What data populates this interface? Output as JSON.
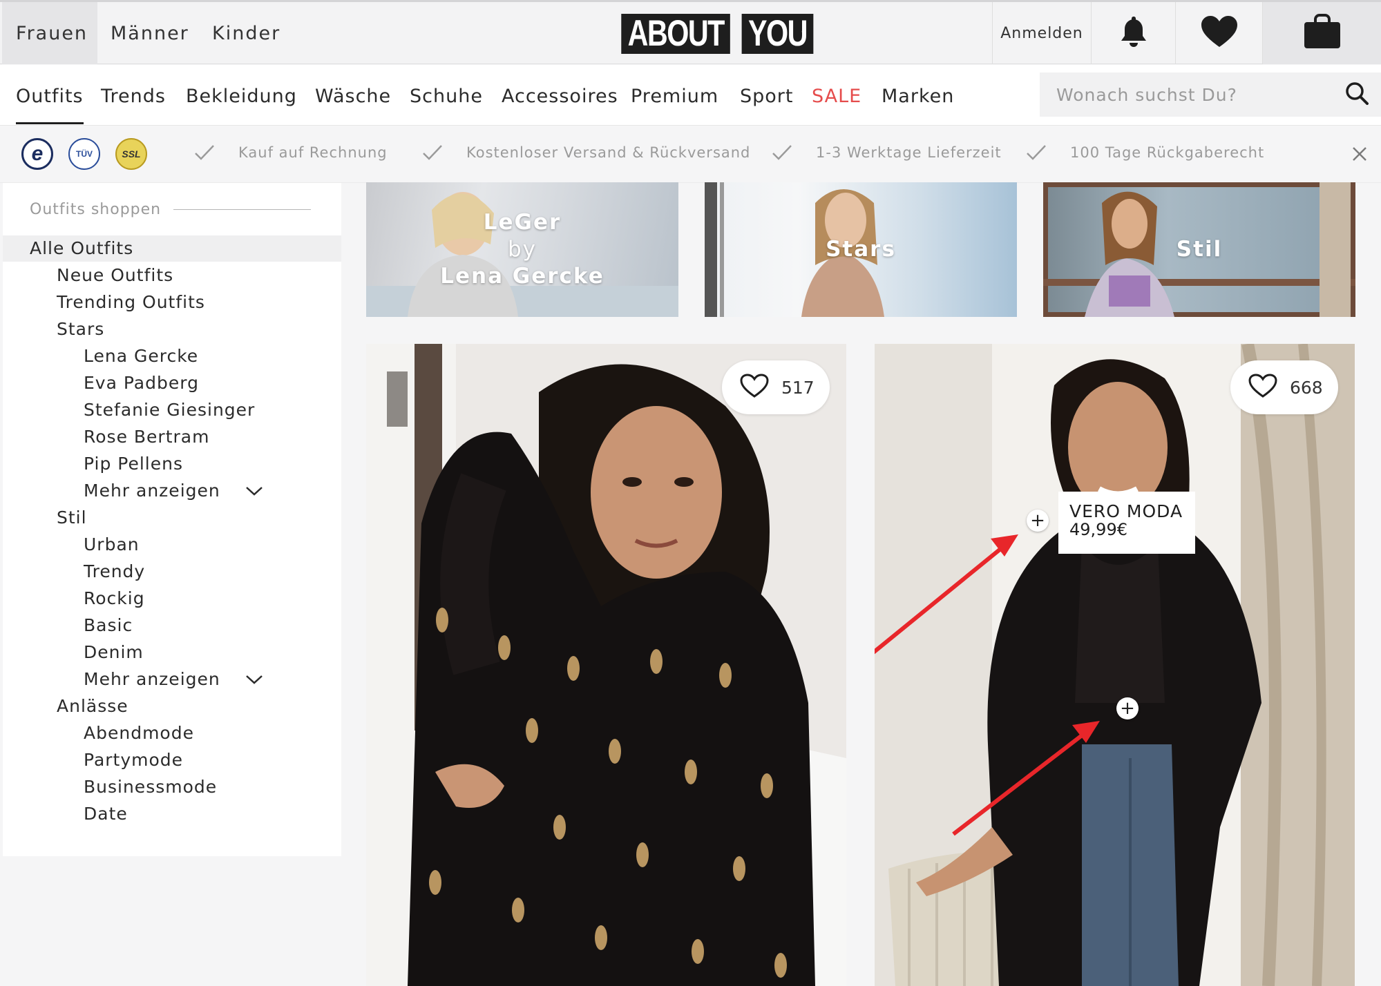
{
  "header": {
    "gender_tabs": [
      "Frauen",
      "Männer",
      "Kinder"
    ],
    "logo": {
      "part1": "ABOUT",
      "part2": "YOU",
      "mark": "°"
    },
    "login_label": "Anmelden",
    "icons": [
      "bell-icon",
      "heart-icon",
      "shopping-bag-icon"
    ]
  },
  "nav": {
    "categories": [
      "Outfits",
      "Trends",
      "Bekleidung",
      "Wäsche",
      "Schuhe",
      "Accessoires",
      "Premium",
      "Sport",
      "SALE",
      "Marken"
    ],
    "active": "Outfits",
    "search_placeholder": "Wonach suchst Du?"
  },
  "trust": {
    "seals": [
      "e",
      "TÜV",
      "SSL"
    ],
    "usps": [
      "Kauf auf Rechnung",
      "Kostenloser Versand & Rückversand",
      "1-3 Werktage Lieferzeit",
      "100 Tage Rückgaberecht"
    ]
  },
  "sidebar": {
    "heading": "Outfits shoppen",
    "items": [
      "Alle Outfits",
      "Neue Outfits",
      "Trending Outfits",
      "Stars",
      "Lena Gercke",
      "Eva Padberg",
      "Stefanie Giesinger",
      "Rose Bertram",
      "Pip Pellens",
      "Mehr anzeigen",
      "Stil",
      "Urban",
      "Trendy",
      "Rockig",
      "Basic",
      "Denim",
      "Mehr anzeigen",
      "Anlässe",
      "Abendmode",
      "Partymode",
      "Businessmode",
      "Date"
    ]
  },
  "teasers": [
    {
      "line1": "LeGer",
      "line2": "by",
      "line3": "Lena Gercke"
    },
    {
      "line1": "Stars"
    },
    {
      "line1": "Stil"
    }
  ],
  "outfits": [
    {
      "likes": "517"
    },
    {
      "likes": "668",
      "tag": {
        "brand": "VERO MODA",
        "price": "49,99€"
      }
    }
  ],
  "colors": {
    "sale": "#e54c4c",
    "annotation_arrow": "#e8262a",
    "logo_bg": "#1e1e1e"
  }
}
